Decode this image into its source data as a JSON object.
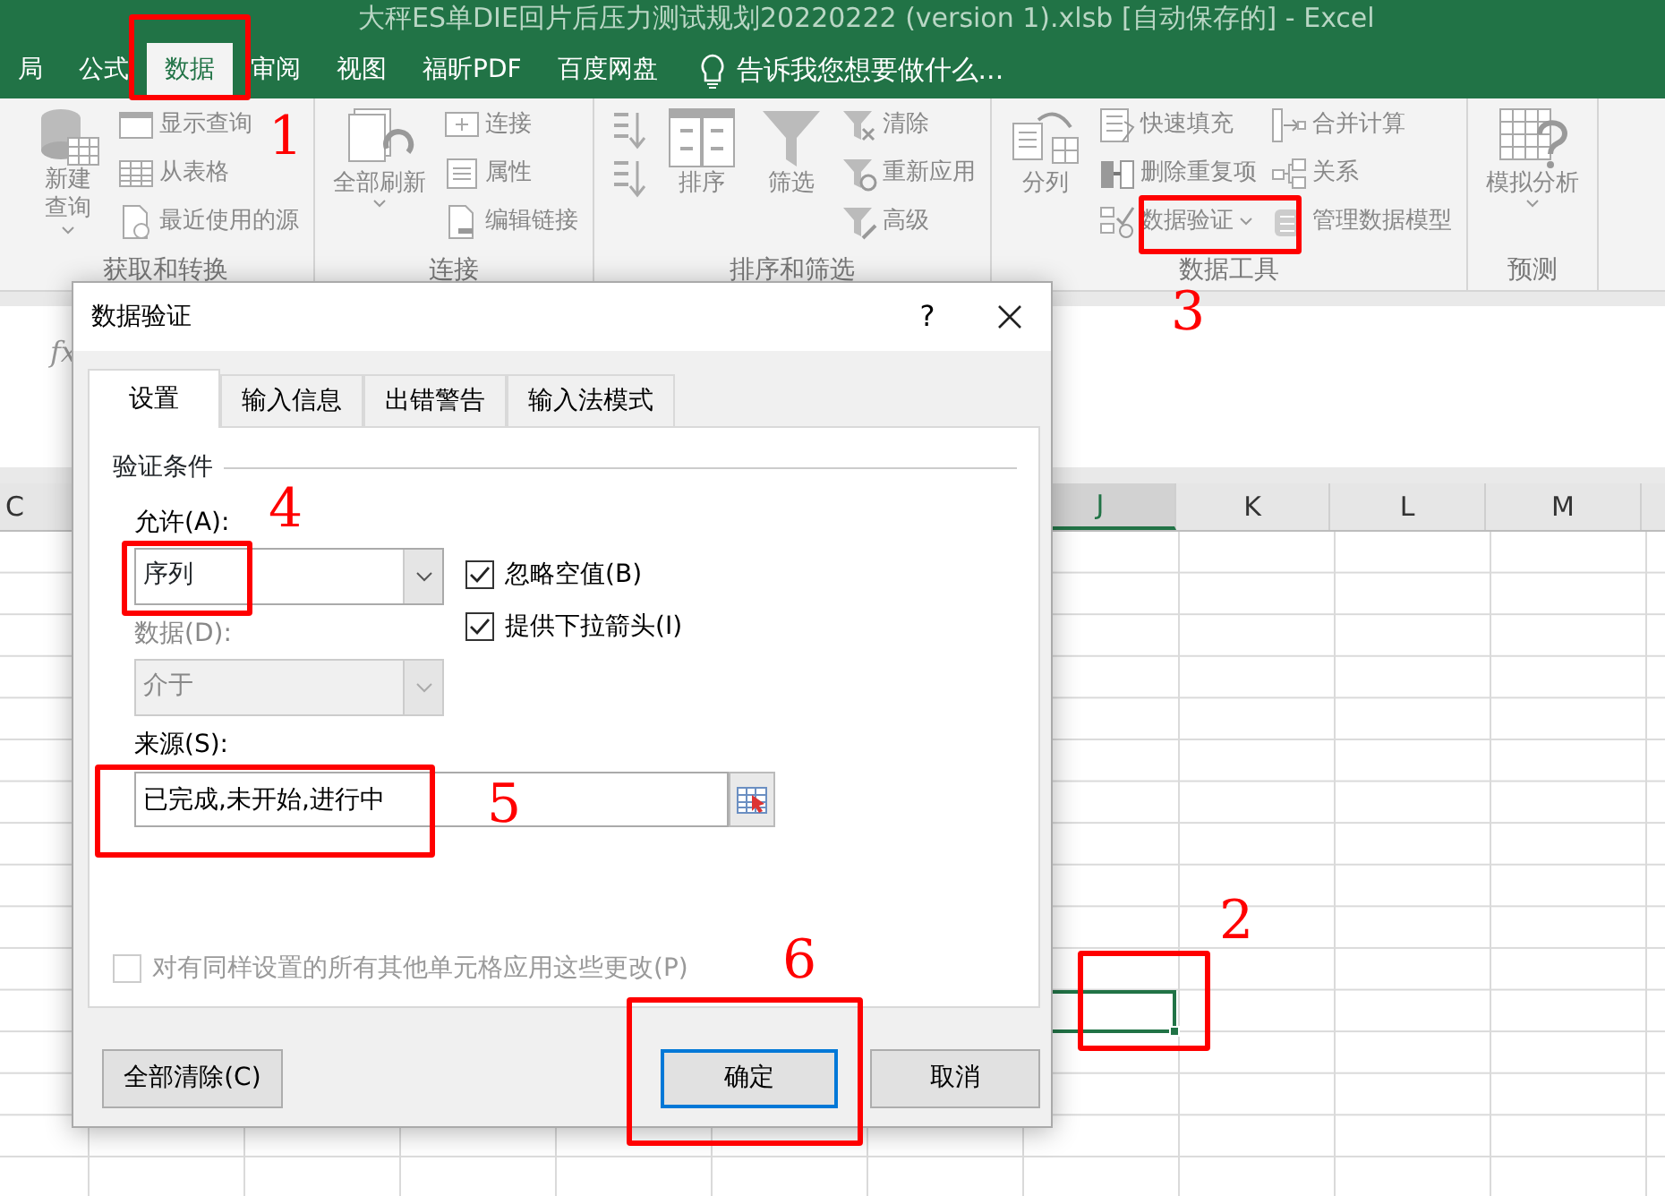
{
  "window": {
    "title": "大秤ES单DIE回片后压力测试规划20220222 (version 1).xlsb [自动保存的] - Excel"
  },
  "ribbon_tabs": [
    {
      "label": "局",
      "selected": false
    },
    {
      "label": "公式",
      "selected": false
    },
    {
      "label": "数据",
      "selected": true
    },
    {
      "label": "审阅",
      "selected": false
    },
    {
      "label": "视图",
      "selected": false
    },
    {
      "label": "福昕PDF",
      "selected": false
    },
    {
      "label": "百度网盘",
      "selected": false
    }
  ],
  "tell_me": {
    "placeholder": "告诉我您想要做什么..."
  },
  "ribbon_groups": [
    {
      "label": "获取和转换",
      "items": [
        {
          "label": "新建查询",
          "kind": "large",
          "dropdown": true
        },
        {
          "label": "显示查询",
          "kind": "small"
        },
        {
          "label": "从表格",
          "kind": "small"
        },
        {
          "label": "最近使用的源",
          "kind": "small"
        }
      ]
    },
    {
      "label": "连接",
      "items": [
        {
          "label": "全部刷新",
          "kind": "large",
          "dropdown": true
        },
        {
          "label": "连接",
          "kind": "small"
        },
        {
          "label": "属性",
          "kind": "small"
        },
        {
          "label": "编辑链接",
          "kind": "small"
        }
      ]
    },
    {
      "label": "排序和筛选",
      "items": [
        {
          "kind": "icon"
        },
        {
          "kind": "icon"
        },
        {
          "label": "排序",
          "kind": "large"
        },
        {
          "label": "筛选",
          "kind": "large"
        },
        {
          "label": "清除",
          "kind": "small"
        },
        {
          "label": "重新应用",
          "kind": "small"
        },
        {
          "label": "高级",
          "kind": "small"
        }
      ]
    },
    {
      "label": "数据工具",
      "items": [
        {
          "label": "分列",
          "kind": "large"
        },
        {
          "label": "快速填充",
          "kind": "small"
        },
        {
          "label": "删除重复项",
          "kind": "small"
        },
        {
          "label": "数据验证",
          "kind": "small",
          "dropdown": true
        },
        {
          "label": "合并计算",
          "kind": "small"
        },
        {
          "label": "关系",
          "kind": "small"
        },
        {
          "label": "管理数据模型",
          "kind": "small"
        }
      ]
    },
    {
      "label": "预测",
      "items": [
        {
          "label": "模拟分析",
          "kind": "large",
          "dropdown": true
        }
      ]
    }
  ],
  "formula_bar": {
    "label": "fx"
  },
  "sheet": {
    "columns": [
      {
        "label": "C",
        "selected": false
      },
      {
        "label": "J",
        "selected": true
      },
      {
        "label": "K",
        "selected": false
      },
      {
        "label": "L",
        "selected": false
      },
      {
        "label": "M",
        "selected": false
      }
    ]
  },
  "dialog": {
    "title": "数据验证",
    "help": "?",
    "tabs": [
      {
        "label": "设置",
        "selected": true
      },
      {
        "label": "输入信息",
        "selected": false
      },
      {
        "label": "出错警告",
        "selected": false
      },
      {
        "label": "输入法模式",
        "selected": false
      }
    ],
    "section": "验证条件",
    "selects": [
      {
        "label": "允许(A):",
        "value": "序列",
        "disabled": false
      },
      {
        "label": "数据(D):",
        "value": "介于",
        "disabled": true
      }
    ],
    "options": [
      {
        "label": "忽略空值(B)",
        "checked": true,
        "disabled": false
      },
      {
        "label": "提供下拉箭头(I)",
        "checked": true,
        "disabled": false
      }
    ],
    "source": {
      "label": "来源(S):",
      "value": "已完成,未开始,进行中"
    },
    "apply_all": {
      "label": "对有同样设置的所有其他单元格应用这些更改(P)",
      "checked": false,
      "disabled": true
    },
    "buttons": [
      {
        "label": "全部清除(C)",
        "default": false
      },
      {
        "label": "确定",
        "default": true
      },
      {
        "label": "取消",
        "default": false
      }
    ]
  },
  "annotations": [
    {
      "number": "1"
    },
    {
      "number": "2"
    },
    {
      "number": "3"
    },
    {
      "number": "4"
    },
    {
      "number": "5"
    },
    {
      "number": "6"
    }
  ]
}
